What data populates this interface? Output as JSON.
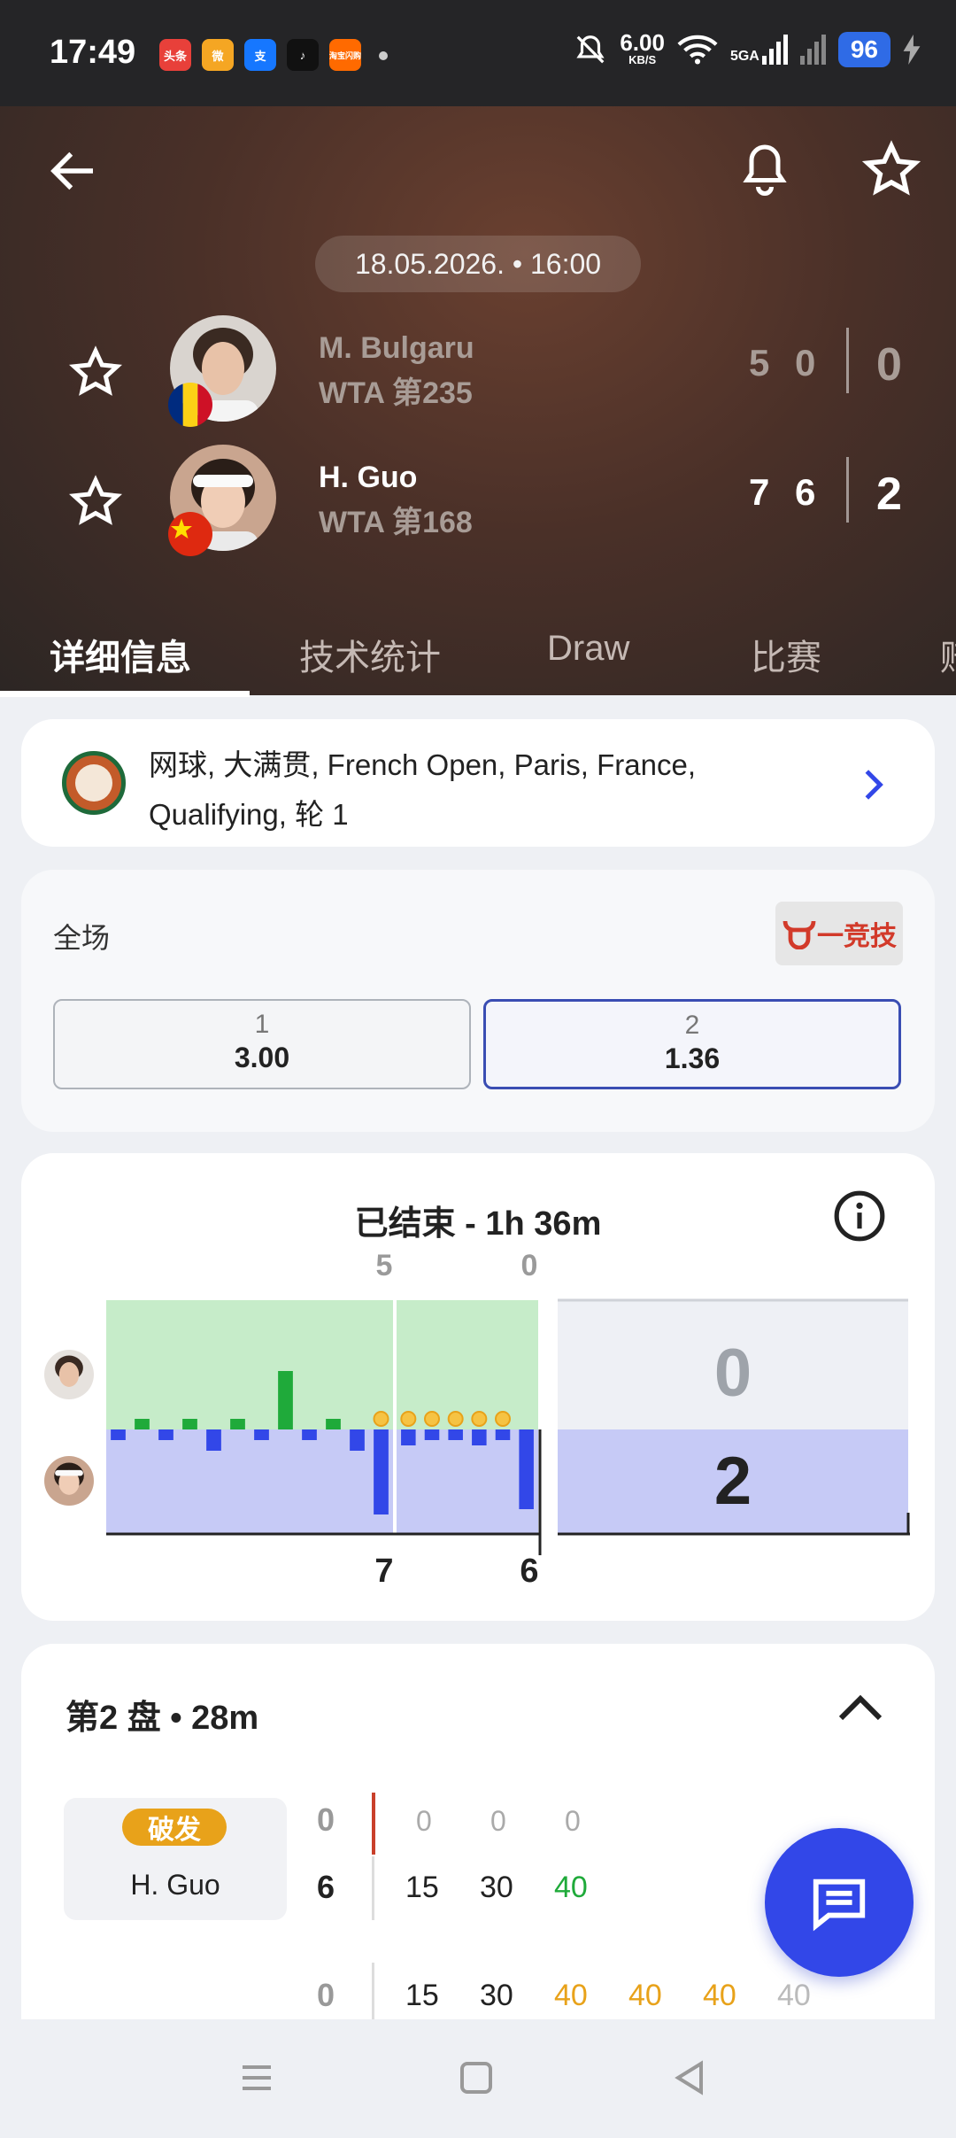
{
  "status_bar": {
    "time": "17:49",
    "apps": [
      {
        "name": "toutiao-icon",
        "label": "头条",
        "color": "#e8403a"
      },
      {
        "name": "weibo-icon",
        "label": "微",
        "color": "#f5a623"
      },
      {
        "name": "alipay-icon",
        "label": "支",
        "color": "#1677ff"
      },
      {
        "name": "tiktok-icon",
        "label": "♪",
        "color": "#111111"
      },
      {
        "name": "taobao-flash-icon",
        "label": "淘宝闪购",
        "color": "#ff6a00"
      }
    ],
    "net_speed": "6.00",
    "net_unit": "KB/S",
    "signal": "5GA",
    "battery": "96"
  },
  "header": {
    "date_time": "18.05.2026. • 16:00",
    "players": [
      {
        "name": "M. Bulgaru",
        "rank": "WTA 第235",
        "sets": [
          "5",
          "0"
        ],
        "total": "0",
        "winner": false,
        "flag": "romania"
      },
      {
        "name": "H. Guo",
        "rank": "WTA 第168",
        "sets": [
          "7",
          "6"
        ],
        "total": "2",
        "winner": true,
        "flag": "china"
      }
    ],
    "tabs": [
      "详细信息",
      "技术统计",
      "Draw",
      "比赛",
      "赔"
    ]
  },
  "tournament": {
    "title": "网球, 大满贯, French Open, Paris, France, Qualifying, 轮 1"
  },
  "odds": {
    "label": "全场",
    "bookmaker": "一竞技",
    "options": [
      {
        "label": "1",
        "value": "3.00",
        "selected": false
      },
      {
        "label": "2",
        "value": "1.36",
        "selected": true
      }
    ]
  },
  "momentum": {
    "status": "已结束 - 1h 36m",
    "set_scores_top": [
      "5",
      "0"
    ],
    "set_scores_bottom": [
      "7",
      "6"
    ],
    "total_top": "0",
    "total_bottom": "2"
  },
  "chart_data": {
    "type": "bar",
    "title": "已结束 - 1h 36m",
    "description_series": [
      {
        "name": "M. Bulgaru",
        "color": "#1faa3a"
      },
      {
        "name": "H. Guo",
        "color": "#3247e8"
      }
    ],
    "sets": [
      {
        "games_top": "5",
        "games_bottom": "7",
        "values": [
          -0.2,
          0.2,
          -0.2,
          0.2,
          -0.4,
          0.2,
          -0.2,
          1.1,
          -0.2,
          0.2,
          -0.4,
          -1.6
        ]
      },
      {
        "games_top": "0",
        "games_bottom": "6",
        "values": [
          -0.3,
          -0.2,
          -0.2,
          -0.3,
          -0.2,
          -1.5
        ]
      }
    ],
    "break_markers": {
      "set1": [
        11
      ],
      "set2": [
        0,
        1,
        2,
        3,
        4
      ]
    },
    "ylim": [
      -2,
      2
    ]
  },
  "set_detail": {
    "title": "第2 盘 • 28m",
    "badge": "破发",
    "server": "H. Guo",
    "game1": {
      "top_game": "0",
      "bottom_game": "6",
      "top_points": [
        "0",
        "0",
        "0"
      ],
      "bottom_points": [
        "15",
        "30",
        "40"
      ]
    },
    "game2": {
      "game": "0",
      "points": [
        "15",
        "30",
        "40",
        "40",
        "40",
        "40"
      ]
    }
  },
  "colors": {
    "accent": "#3247e8",
    "win_green": "#1faa3a",
    "deuce_orange": "#e8a21a",
    "serve_red": "#c9402a"
  }
}
